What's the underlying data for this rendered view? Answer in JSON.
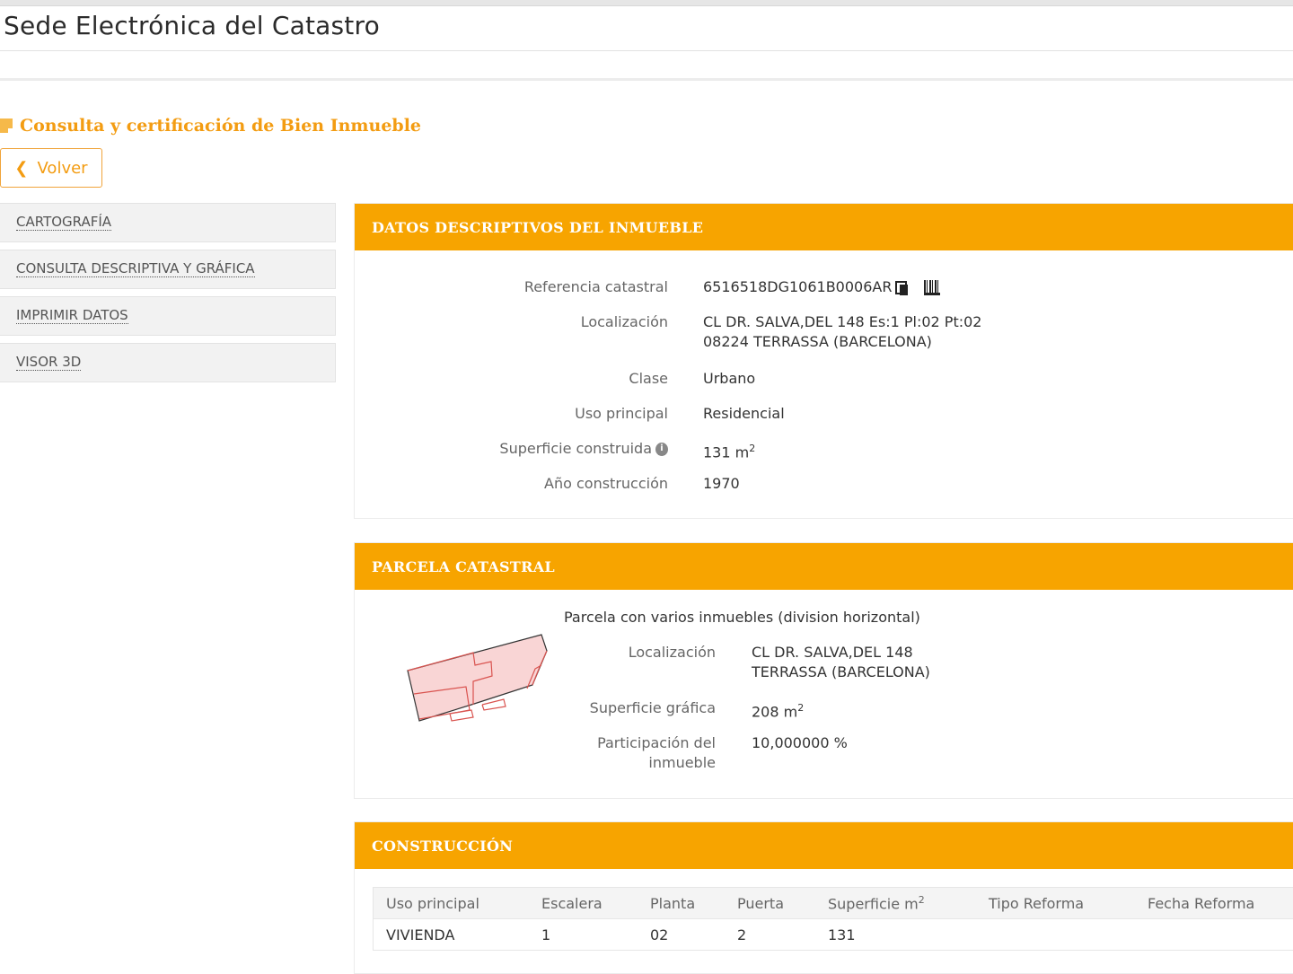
{
  "header": {
    "title": "Sede Electrónica del Catastro"
  },
  "page": {
    "section_title": "Consulta y certificación de Bien Inmueble",
    "back_label": "Volver"
  },
  "sidebar": {
    "items": [
      {
        "label": "CARTOGRAFÍA"
      },
      {
        "label": "CONSULTA DESCRIPTIVA Y GRÁFICA"
      },
      {
        "label": "IMPRIMIR DATOS"
      },
      {
        "label": "VISOR 3D"
      }
    ]
  },
  "datos": {
    "heading": "DATOS DESCRIPTIVOS DEL INMUEBLE",
    "ref_label": "Referencia catastral",
    "ref_value": "6516518DG1061B0006AR",
    "loc_label": "Localización",
    "loc_line1": "CL DR. SALVA,DEL 148 Es:1 Pl:02 Pt:02",
    "loc_line2": "08224 TERRASSA (BARCELONA)",
    "clase_label": "Clase",
    "clase_value": "Urbano",
    "uso_label": "Uso principal",
    "uso_value": "Residencial",
    "sup_label": "Superficie construida",
    "sup_value": "131 m",
    "sup_sup": "2",
    "anio_label": "Año construcción",
    "anio_value": "1970"
  },
  "parcela": {
    "heading": "PARCELA CATASTRAL",
    "subtitle": "Parcela con varios inmuebles (division horizontal)",
    "loc_label": "Localización",
    "loc_line1": "CL DR. SALVA,DEL 148",
    "loc_line2": "TERRASSA (BARCELONA)",
    "sup_label": "Superficie gráfica",
    "sup_value": "208 m",
    "sup_sup": "2",
    "part_label1": "Participación del",
    "part_label2": "inmueble",
    "part_value": "10,000000 %"
  },
  "construccion": {
    "heading": "CONSTRUCCIÓN",
    "columns": [
      "Uso principal",
      "Escalera",
      "Planta",
      "Puerta",
      "Superficie m",
      "Tipo Reforma",
      "Fecha Reforma"
    ],
    "col_sup": "2",
    "rows": [
      [
        "VIVIENDA",
        "1",
        "02",
        "2",
        "131",
        "",
        ""
      ]
    ]
  },
  "colors": {
    "accent": "#f7a400",
    "title_orange": "#f39c12",
    "parcel_fill": "#f9d5d5",
    "parcel_stroke": "#d9534f"
  },
  "icons": [
    "document-icon",
    "chevron-left-icon",
    "copy-icon",
    "barcode-icon",
    "info-icon"
  ]
}
